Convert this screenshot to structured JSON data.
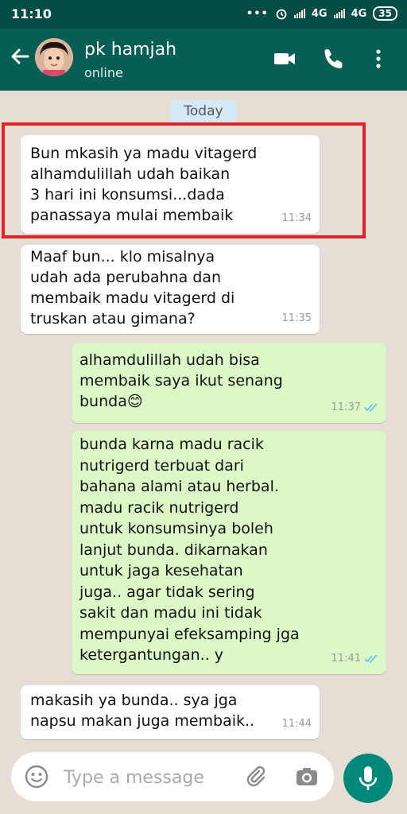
{
  "status_bar": {
    "time": "11:10",
    "network1": "4G",
    "network2": "4G",
    "battery": "35"
  },
  "header": {
    "contact_name": "pk hamjah",
    "contact_status": "online",
    "icons": [
      "back-arrow-icon",
      "video-call-icon",
      "phone-icon",
      "more-vert-icon"
    ],
    "colors": {
      "toolbar": "#075e54",
      "status": "#054d44"
    }
  },
  "chat": {
    "date_label": "Today",
    "messages": [
      {
        "direction": "in",
        "text": "Bun mkasih ya madu vitagerd\nalhamdulillah udah baikan\n3 hari ini konsumsi...dada\npanassaya mulai membaik",
        "time": "11:34"
      },
      {
        "direction": "in",
        "text": "Maaf bun... klo misalnya\nudah ada perubahna dan\nmembaik  madu vitagerd di\ntruskan atau gimana?",
        "time": "11:35"
      },
      {
        "direction": "out",
        "text": "alhamdulillah udah bisa\nmembaik saya ikut senang\nbunda😊",
        "time": "11:37"
      },
      {
        "direction": "out",
        "text": "bunda karna madu racik\nnutrigerd terbuat  dari\nbahana alami atau herbal.\nmadu racik nutrigerd\nuntuk konsumsinya boleh\nlanjut bunda. dikarnakan\nuntuk jaga kesehatan\njuga.. agar tidak sering\nsakit dan madu ini tidak\nmempunyai efeksamping jga\nketergantungan.. y",
        "time": "11:41"
      },
      {
        "direction": "in",
        "text": "makasih ya bunda.. sya jga\nnapsu makan juga membaik..",
        "time": "11:44"
      }
    ],
    "colors": {
      "incoming": "#ffffff",
      "outgoing": "#dcf8c6",
      "highlight": "#e0222a",
      "read_ticks": "#4fc3f7"
    }
  },
  "composer": {
    "placeholder": "Type a message",
    "icons": [
      "emoji-icon",
      "attach-icon",
      "camera-icon",
      "mic-icon"
    ]
  }
}
